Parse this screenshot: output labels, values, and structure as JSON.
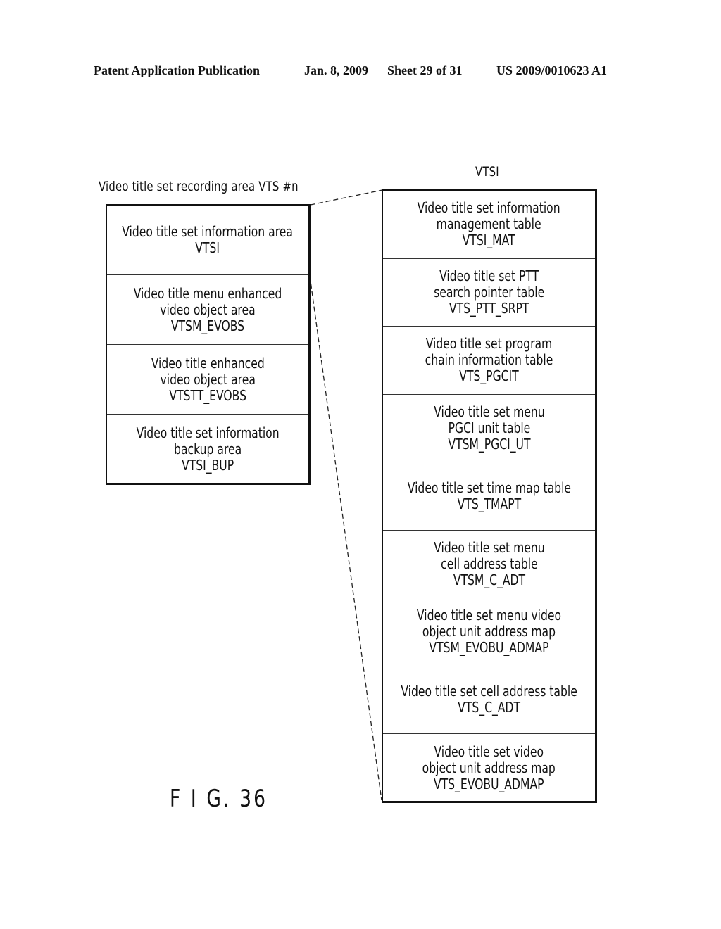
{
  "header": {
    "publication": "Patent Application Publication",
    "date": "Jan. 8, 2009",
    "sheet": "Sheet 29 of 31",
    "number": "US 2009/0010623 A1"
  },
  "left": {
    "title": "Video title set recording area VTS #n",
    "cells": [
      {
        "lines": [
          "Video title set information area",
          "VTSI"
        ]
      },
      {
        "lines": [
          "Video title menu enhanced",
          "video object area",
          "VTSM_EVOBS"
        ]
      },
      {
        "lines": [
          "Video title enhanced",
          "video object area",
          "VTSTT_EVOBS"
        ]
      },
      {
        "lines": [
          "Video title set information",
          "backup area",
          "VTSI_BUP"
        ]
      }
    ]
  },
  "right": {
    "title": "VTSI",
    "cells": [
      {
        "lines": [
          "Video title set information",
          "management table",
          "VTSI_MAT"
        ]
      },
      {
        "lines": [
          "Video title set PTT",
          "search pointer table",
          "VTS_PTT_SRPT"
        ]
      },
      {
        "lines": [
          "Video title set program",
          "chain information table",
          "VTS_PGCIT"
        ]
      },
      {
        "lines": [
          "Video title set menu",
          "PGCI unit table",
          "VTSM_PGCI_UT"
        ]
      },
      {
        "lines": [
          "Video title set time map table",
          "VTS_TMAPT"
        ]
      },
      {
        "lines": [
          "Video title set menu",
          "cell address table",
          "VTSM_C_ADT"
        ]
      },
      {
        "lines": [
          "Video title set menu video",
          "object unit address map",
          "VTSM_EVOBU_ADMAP"
        ]
      },
      {
        "lines": [
          "Video title set cell address table",
          "VTS_C_ADT"
        ]
      },
      {
        "lines": [
          "Video title set video",
          "object unit address map",
          "VTS_EVOBU_ADMAP"
        ]
      }
    ]
  },
  "figure_label": "F I G. 36"
}
